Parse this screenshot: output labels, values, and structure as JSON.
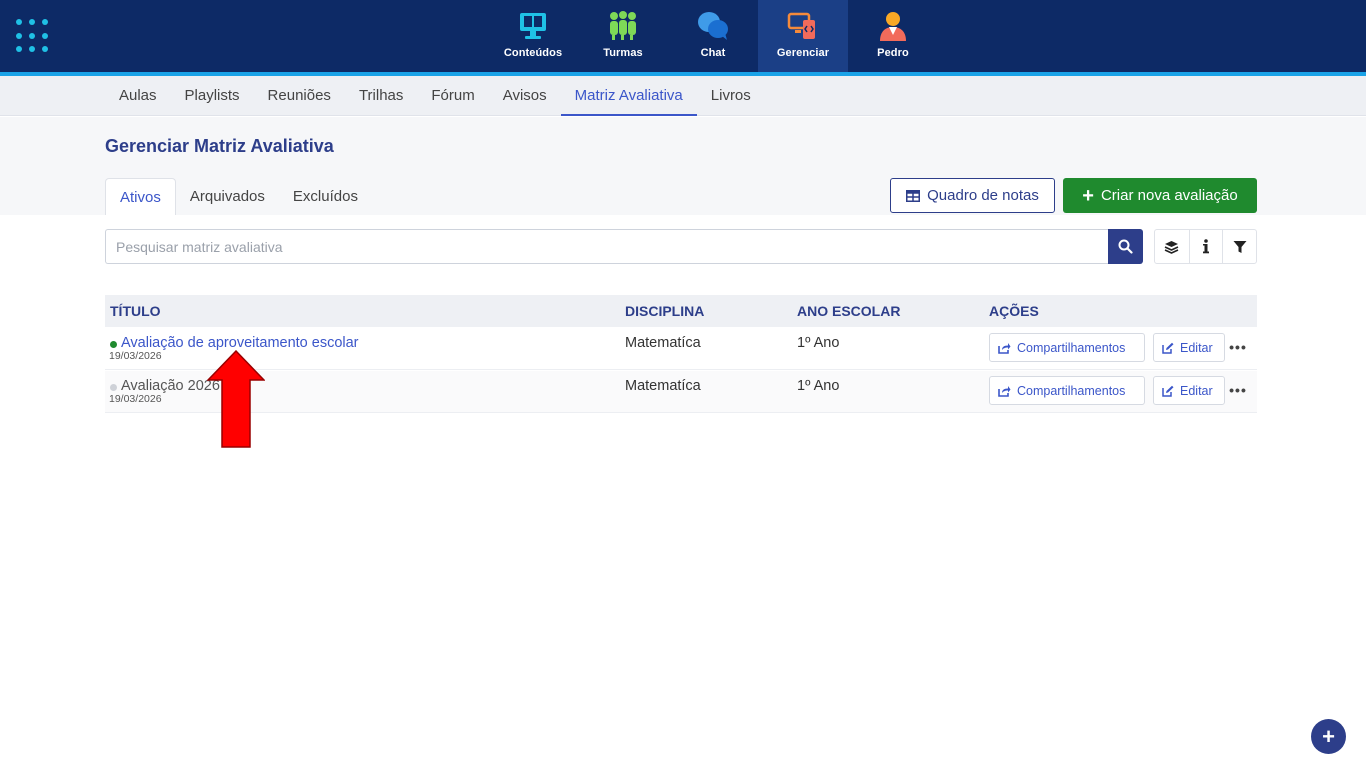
{
  "topnav": {
    "items": [
      {
        "label": "Conteúdos",
        "icon": "content-monitor-icon"
      },
      {
        "label": "Turmas",
        "icon": "classes-people-icon"
      },
      {
        "label": "Chat",
        "icon": "chat-bubbles-icon"
      },
      {
        "label": "Gerenciar",
        "icon": "manage-devices-icon",
        "active": true
      },
      {
        "label": "Pedro",
        "icon": "user-avatar-icon"
      }
    ]
  },
  "subnav": {
    "items": [
      "Aulas",
      "Playlists",
      "Reuniões",
      "Trilhas",
      "Fórum",
      "Avisos",
      "Matriz Avaliativa",
      "Livros"
    ],
    "active": "Matriz Avaliativa"
  },
  "page": {
    "title": "Gerenciar Matriz Avaliativa"
  },
  "tabs": {
    "items": [
      "Ativos",
      "Arquivados",
      "Excluídos"
    ],
    "active": "Ativos"
  },
  "actions": {
    "grades_label": "Quadro de notas",
    "create_label": "Criar nova avaliação"
  },
  "search": {
    "placeholder": "Pesquisar matriz avaliativa",
    "value": ""
  },
  "table": {
    "columns": [
      "TÍTULO",
      "DISCIPLINA",
      "ANO ESCOLAR",
      "AÇÕES"
    ],
    "rows": [
      {
        "title": "Avaliação de aproveitamento escolar",
        "date": "19/03/2026",
        "subject": "Matematíca",
        "year": "1º Ano",
        "status_color": "#1f8a2e",
        "share_label": "Compartilhamentos",
        "edit_label": "Editar"
      },
      {
        "title": "Avaliação 2026",
        "date": "19/03/2026",
        "subject": "Matematíca",
        "year": "1º Ano",
        "status_color": "#cfd2d8",
        "share_label": "Compartilhamentos",
        "edit_label": "Editar"
      }
    ]
  },
  "fab": {
    "label": "+"
  },
  "colors": {
    "topbar": "#0d2a66",
    "accent": "#1aa3e8",
    "primary": "#2d3e8a",
    "link": "#3b56c9",
    "success": "#1f8a2e",
    "annotation": "#ff0000"
  }
}
